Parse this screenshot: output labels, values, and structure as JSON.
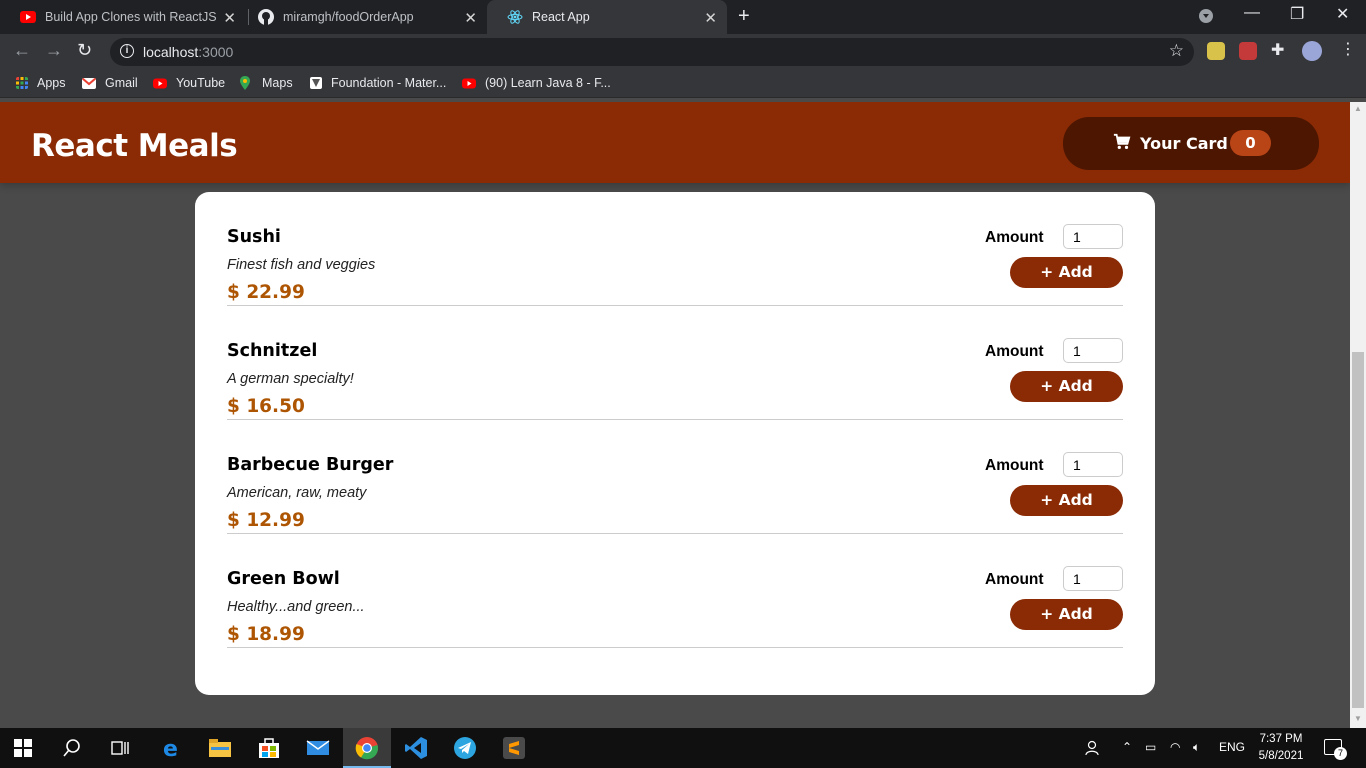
{
  "browser": {
    "tabs": [
      {
        "title": "Build App Clones with ReactJS - Y",
        "icon": "youtube-icon"
      },
      {
        "title": "miramgh/foodOrderApp",
        "icon": "github-icon"
      },
      {
        "title": "React App",
        "icon": "react-icon"
      }
    ],
    "url_host": "localhost",
    "url_port": ":3000",
    "bookmarks": [
      "Apps",
      "Gmail",
      "YouTube",
      "Maps",
      "Foundation - Mater...",
      "(90) Learn Java 8 - F..."
    ]
  },
  "header": {
    "brand": "React Meals",
    "cart_label": "Your Card",
    "cart_count": "0"
  },
  "meals": [
    {
      "name": "Sushi",
      "description": "Finest fish and veggies",
      "price": "$ 22.99",
      "amount_label": "Amount",
      "amount_value": "1",
      "add_label": "+ Add"
    },
    {
      "name": "Schnitzel",
      "description": "A german specialty!",
      "price": "$ 16.50",
      "amount_label": "Amount",
      "amount_value": "1",
      "add_label": "+ Add"
    },
    {
      "name": "Barbecue Burger",
      "description": "American, raw, meaty",
      "price": "$ 12.99",
      "amount_label": "Amount",
      "amount_value": "1",
      "add_label": "+ Add"
    },
    {
      "name": "Green Bowl",
      "description": "Healthy...and green...",
      "price": "$ 18.99",
      "amount_label": "Amount",
      "amount_value": "1",
      "add_label": "+ Add"
    }
  ],
  "taskbar": {
    "language": "ENG",
    "time": "7:37 PM",
    "date": "5/8/2021",
    "notifications": "7"
  },
  "colors": {
    "header_bg": "#8a2b06",
    "cart_bg": "#4d1601",
    "badge_bg": "#b94517",
    "price": "#ad5502",
    "page_bg": "#4a4a4a"
  }
}
